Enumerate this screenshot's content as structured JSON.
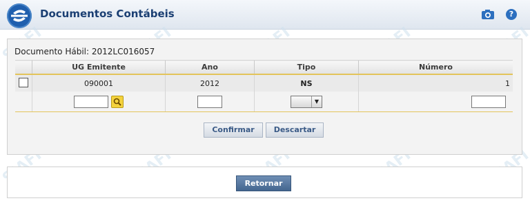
{
  "header": {
    "title": "Documentos Contábeis",
    "camera_icon": "camera-icon",
    "help_icon": "help-icon",
    "help_glyph": "?"
  },
  "watermark": "SIAFI",
  "document": {
    "label": "Documento Hábil: 2012LC016057"
  },
  "table": {
    "columns": [
      "UG Emitente",
      "Ano",
      "Tipo",
      "Número"
    ],
    "row": {
      "ug_emitente": "090001",
      "ano": "2012",
      "tipo": "NS",
      "numero": "1"
    },
    "inputs": {
      "ug_emitente": "",
      "ano": "",
      "tipo": "",
      "numero": ""
    }
  },
  "buttons": {
    "confirm": "Confirmar",
    "discard": "Descartar",
    "return": "Retornar"
  },
  "colors": {
    "header_title": "#1b3f73",
    "accent_border": "#e3c45a",
    "return_button": "#44668f"
  }
}
